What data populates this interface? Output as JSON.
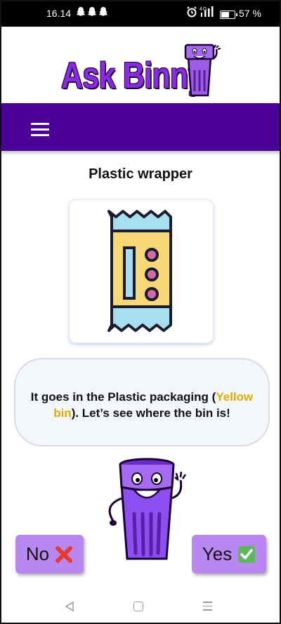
{
  "status_bar": {
    "time": "16.14",
    "notifications": [
      "snapchat-ghost",
      "snapchat-ghost",
      "snapchat-ghost"
    ],
    "network": "4G",
    "battery_percent_text": "57 %",
    "battery_level": 0.57
  },
  "logo": {
    "text": "Ask Binny"
  },
  "item": {
    "title": "Plastic wrapper",
    "image_icon": "plastic-wrapper-icon"
  },
  "answer": {
    "text_before": "It goes in the Plastic packaging (",
    "highlight": "Yellow bin",
    "text_after": "). Let’s see where the bin is!",
    "highlight_color": "#e0ac00"
  },
  "buttons": {
    "no_label": "No",
    "yes_label": "Yes"
  },
  "colors": {
    "brand_purple": "#4b0096",
    "button_purple": "#b987f0",
    "logo_purple": "#8a2be2"
  }
}
